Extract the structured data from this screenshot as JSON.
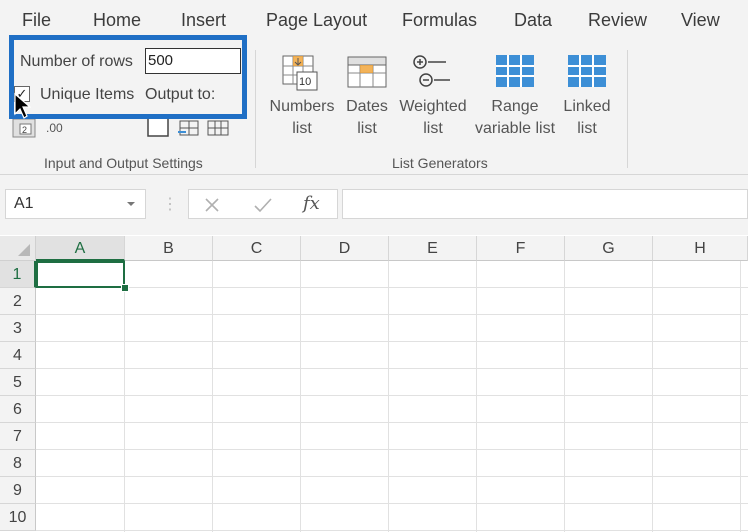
{
  "menu": {
    "items": [
      "File",
      "Home",
      "Insert",
      "Page Layout",
      "Formulas",
      "Data",
      "Review",
      "View"
    ]
  },
  "ribbon": {
    "input_output": {
      "rows_label": "Number of rows",
      "rows_value": "500",
      "unique_items_label": "Unique Items",
      "unique_items_checked": true,
      "output_to_label": "Output to:",
      "decimals_icon_text": ".00",
      "group_title": "Input and Output Settings"
    },
    "list_generators": {
      "numbers_list": [
        "Numbers",
        "list"
      ],
      "dates_list": [
        "Dates",
        "list"
      ],
      "weighted_list": [
        "Weighted",
        "list"
      ],
      "range_variable_list": [
        "Range",
        "variable list"
      ],
      "linked_list": [
        "Linked",
        "list"
      ],
      "numbers_icon_text": "10",
      "group_title": "List Generators"
    }
  },
  "formula_bar": {
    "name_box": "A1",
    "fx_label": "fx",
    "formula": ""
  },
  "grid": {
    "columns": [
      "A",
      "B",
      "C",
      "D",
      "E",
      "F",
      "G",
      "H"
    ],
    "rows": [
      "1",
      "2",
      "3",
      "4",
      "5",
      "6",
      "7",
      "8",
      "9",
      "10"
    ],
    "active_cell": "A1"
  },
  "colors": {
    "highlight": "#1f6fc5",
    "excel_green": "#1e6e42",
    "icon_blue": "#3d8fd6",
    "icon_orange": "#f0a030"
  }
}
